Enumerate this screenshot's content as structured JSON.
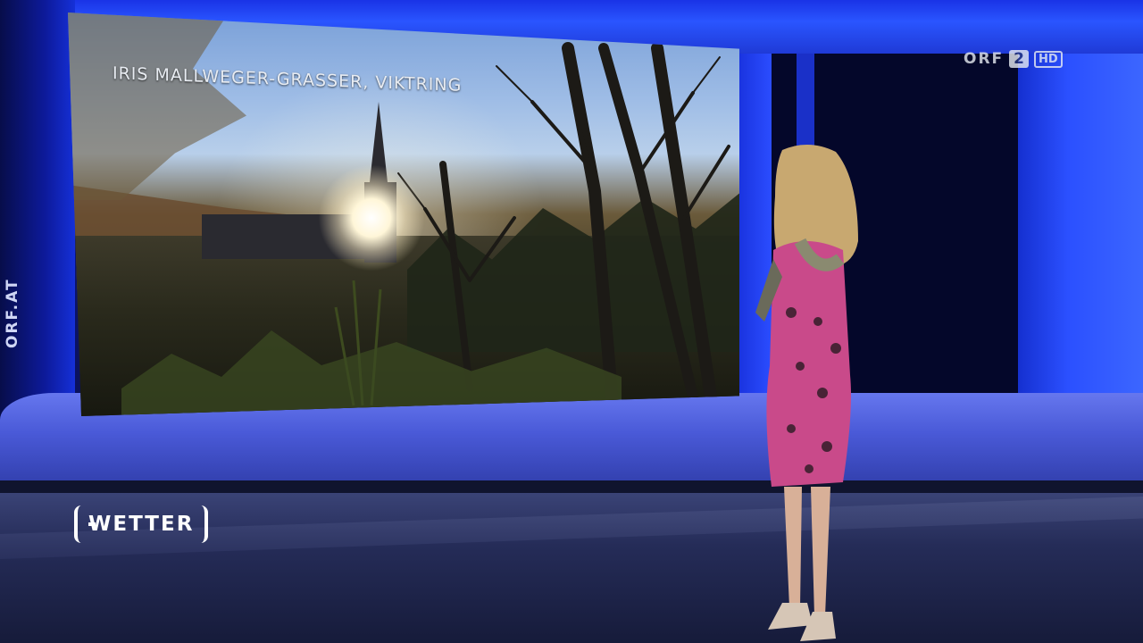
{
  "broadcast": {
    "channel_logo": {
      "name": "ORF",
      "number": "2",
      "quality": "HD"
    },
    "side_url": "ORF.AT",
    "program_label": "WETTER"
  },
  "video_wall": {
    "photo_caption": "IRIS MALLWEGER-GRASSER, VIKTRING"
  },
  "colors": {
    "studio_blue": "#2a55ff",
    "caption_text": "#e8ecf2"
  }
}
